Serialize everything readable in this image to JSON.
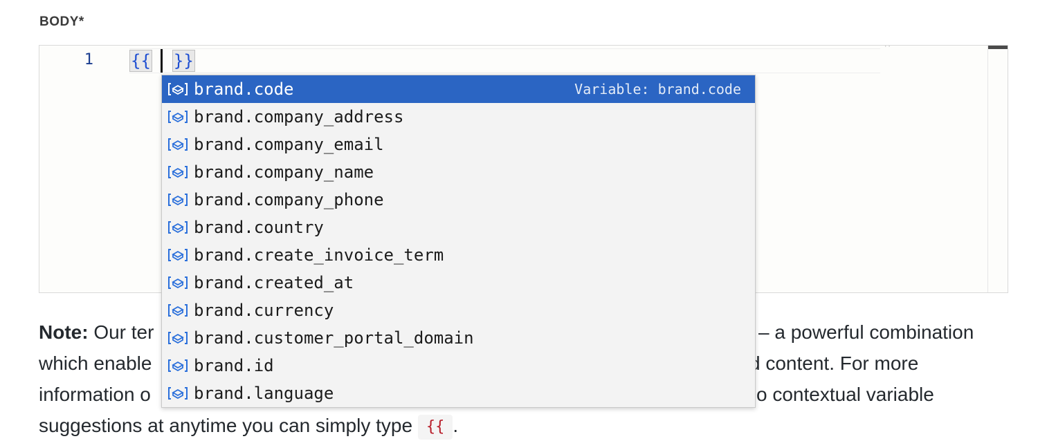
{
  "field": {
    "label": "BODY*"
  },
  "editor": {
    "line_number": "1",
    "open_brace": "{{",
    "close_brace": "}}"
  },
  "suggestions": {
    "selected_detail": "Variable: brand.code",
    "items": [
      {
        "label": "brand.code",
        "icon": "variable-icon"
      },
      {
        "label": "brand.company_address",
        "icon": "variable-icon"
      },
      {
        "label": "brand.company_email",
        "icon": "variable-icon"
      },
      {
        "label": "brand.company_name",
        "icon": "variable-icon"
      },
      {
        "label": "brand.company_phone",
        "icon": "variable-icon"
      },
      {
        "label": "brand.country",
        "icon": "variable-icon"
      },
      {
        "label": "brand.create_invoice_term",
        "icon": "variable-icon"
      },
      {
        "label": "brand.created_at",
        "icon": "variable-icon"
      },
      {
        "label": "brand.currency",
        "icon": "variable-icon"
      },
      {
        "label": "brand.customer_portal_domain",
        "icon": "variable-icon"
      },
      {
        "label": "brand.id",
        "icon": "variable-icon"
      },
      {
        "label": "brand.language",
        "icon": "variable-icon"
      }
    ]
  },
  "note": {
    "bold": "Note:",
    "line1_start": " Our ter",
    "line1_end": "– a powerful combination",
    "line2_start": "which enable",
    "line2_end": "d content. For more",
    "line3_start": "information o",
    "line3_end": "o contextual variable",
    "line4_text": "suggestions at anytime you can simply type ",
    "code": "{{",
    "line4_end": "."
  },
  "colors": {
    "selection": "#2b65c3",
    "brace_text": "#1f4fd1",
    "inline_code": "#b81d2a"
  }
}
